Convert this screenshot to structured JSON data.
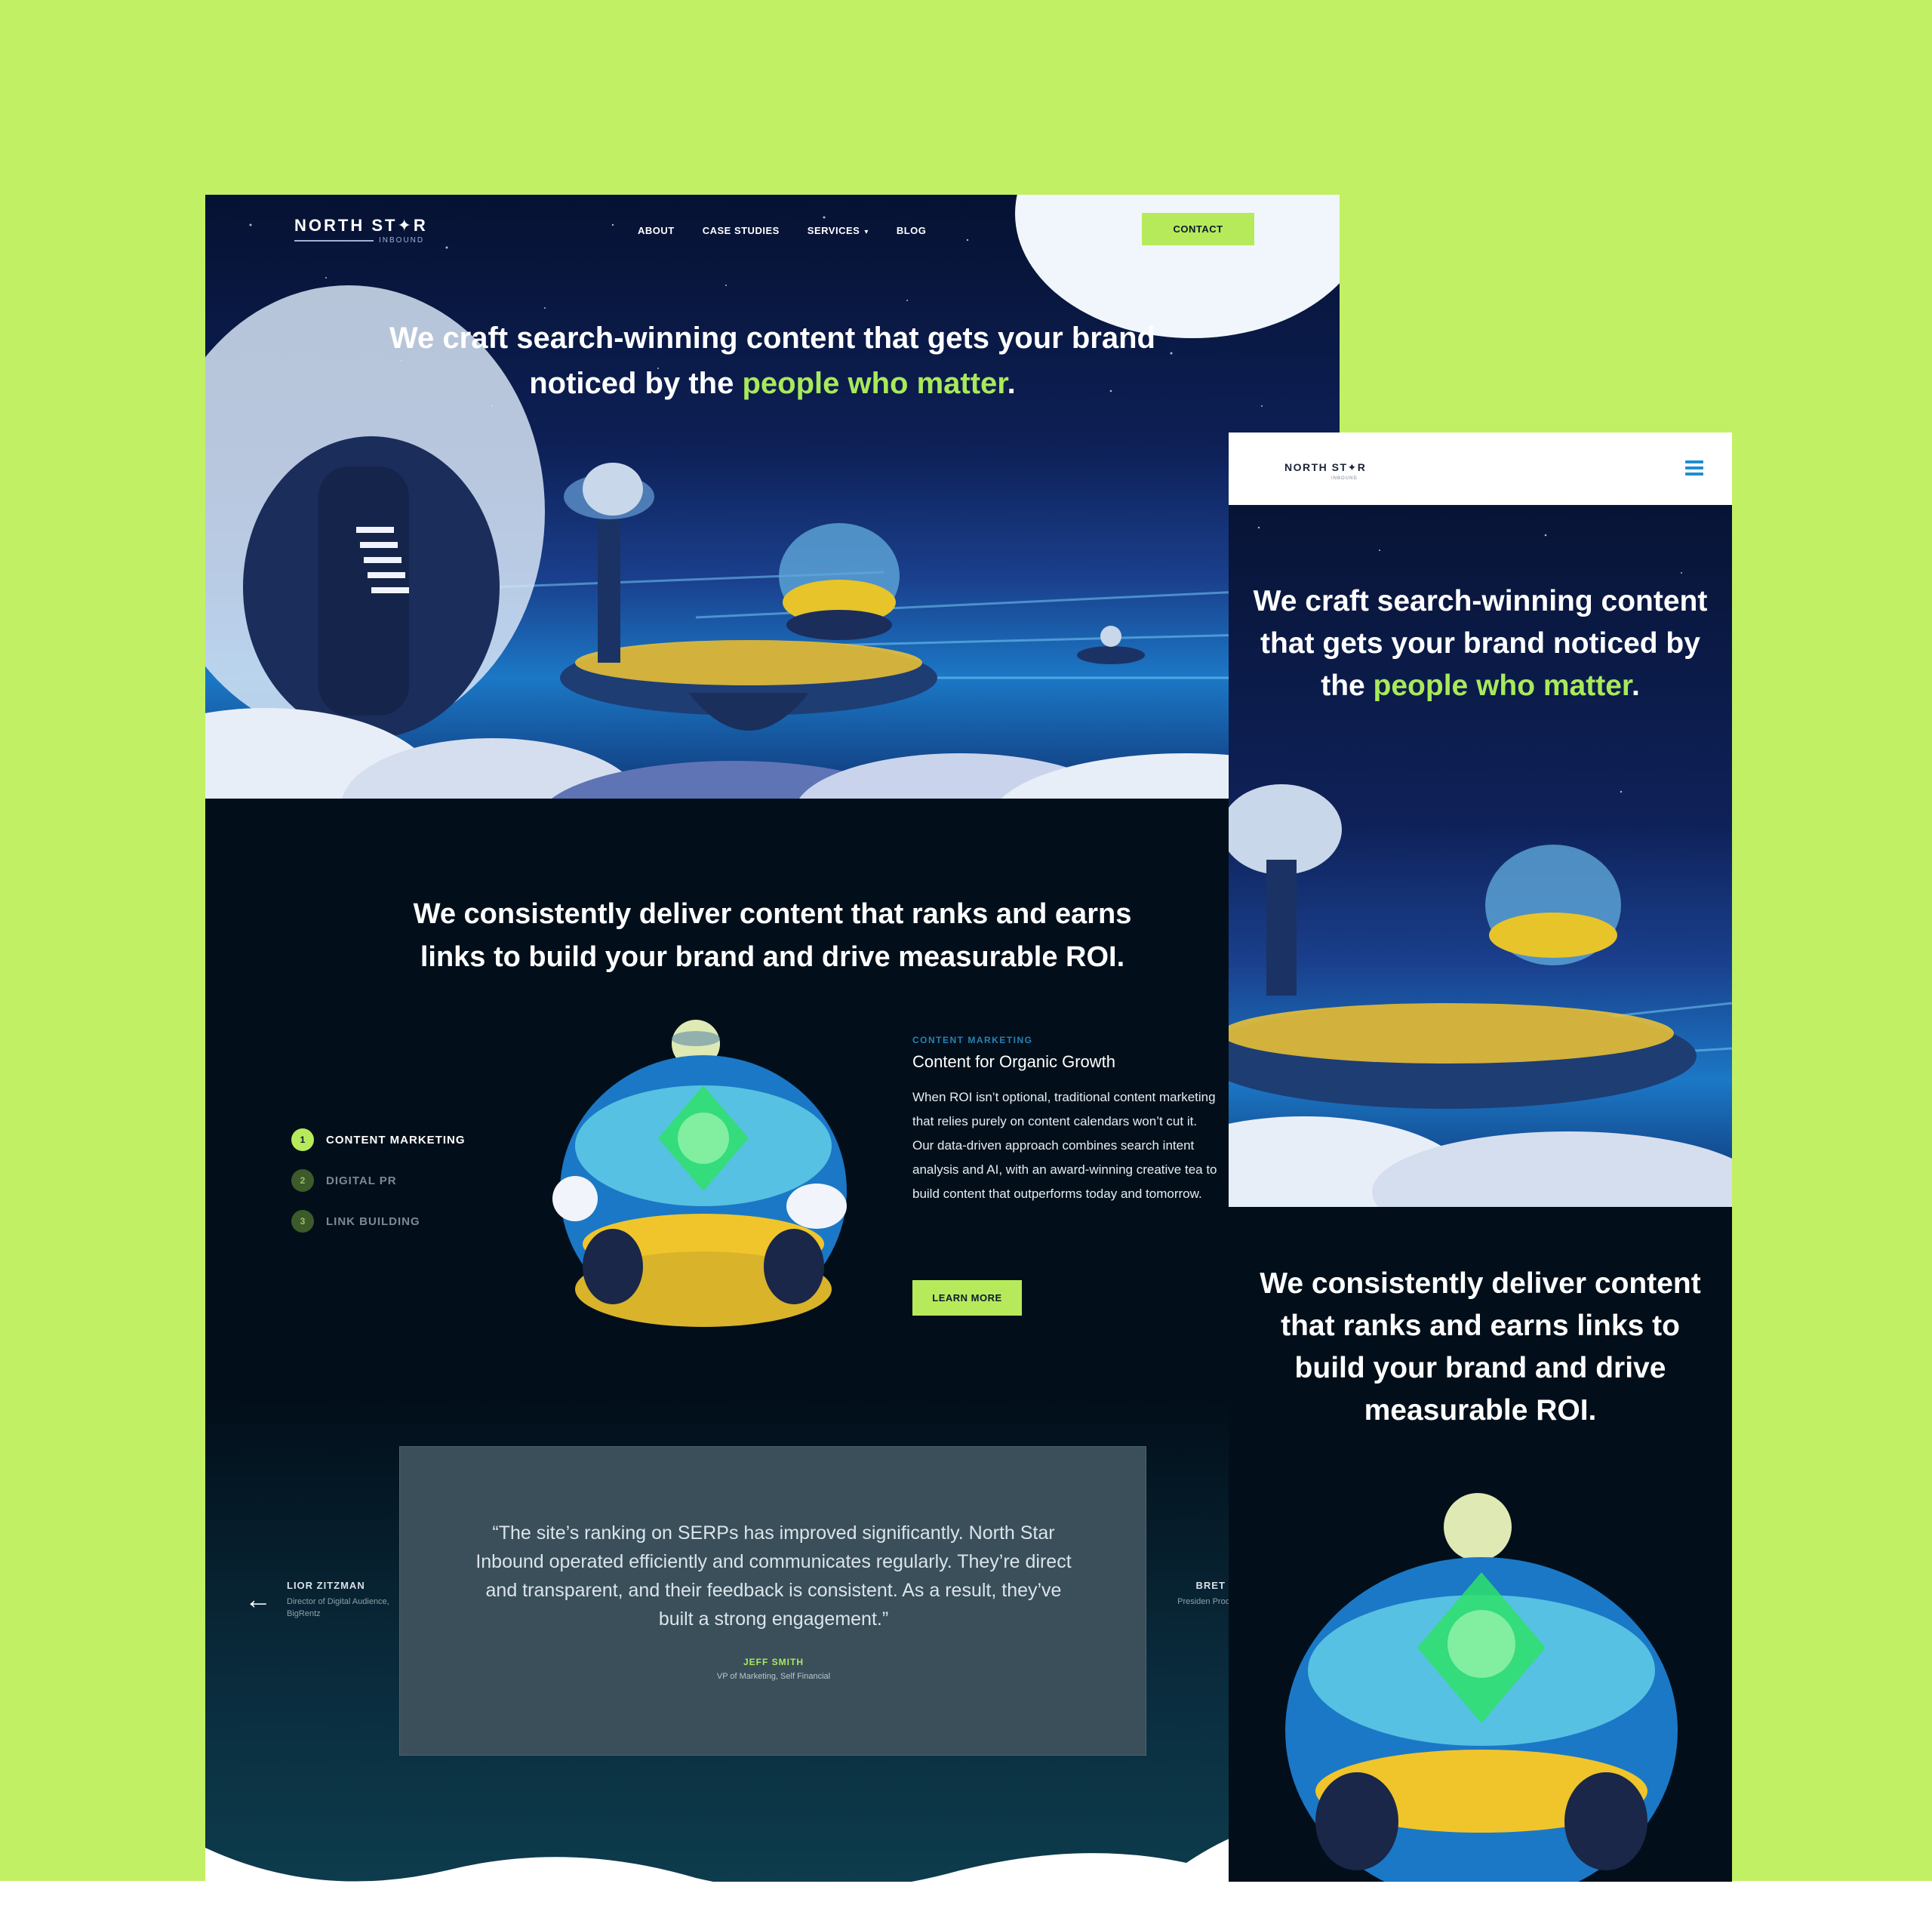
{
  "colors": {
    "background": "#c2f064",
    "accent": "#a8ea5a",
    "button": "#b7ea5b",
    "dark": "#020f1a"
  },
  "desktop": {
    "logo": {
      "text": "NORTH ST✦R",
      "sub": "INBOUND"
    },
    "nav": {
      "items": [
        "ABOUT",
        "CASE STUDIES",
        "SERVICES",
        "BLOG"
      ],
      "contact": "CONTACT"
    },
    "hero": {
      "title_part1": "We craft search-winning content that gets your brand noticed by the ",
      "title_accent": "people who matter",
      "title_end": "."
    },
    "section_title": "We consistently deliver content that ranks and earns links to build your brand and drive measurable ROI.",
    "steps": [
      {
        "num": "1",
        "label": "CONTENT MARKETING"
      },
      {
        "num": "2",
        "label": "DIGITAL PR"
      },
      {
        "num": "3",
        "label": "LINK BUILDING"
      }
    ],
    "content": {
      "kicker": "CONTENT MARKETING",
      "heading": "Content for Organic Growth",
      "p1": "When ROI isn’t optional, traditional content marketing that relies purely on content calendars won’t cut it.",
      "p2": "Our data-driven approach combines search intent analysis and AI, with an award-winning creative tea to build content that outperforms today and tomorrow.",
      "button": "LEARN MORE"
    },
    "testimonial": {
      "quote": "“The site’s ranking on SERPs has improved significantly. North Star Inbound operated efficiently and communicates regularly. They’re direct and transparent, and their feedback is consistent. As a result, they’ve built a strong engagement.”",
      "name": "JEFF SMITH",
      "role": "VP of Marketing, Self Financial",
      "prev_name": "LIOR ZITZMAN",
      "prev_role": "Director of Digital Audience, BigRentz",
      "next_name": "BRET BO",
      "next_role": "Presiden Products Co"
    }
  },
  "mobile": {
    "logo": {
      "text": "NORTH ST✦R",
      "sub": "INBOUND"
    },
    "hero": {
      "title_part1": "We craft search-winning content that gets your brand noticed by the ",
      "title_accent": "people who matter",
      "title_end": "."
    },
    "section_title": "We consistently deliver content that ranks and earns links to build your brand and drive measurable ROI."
  }
}
